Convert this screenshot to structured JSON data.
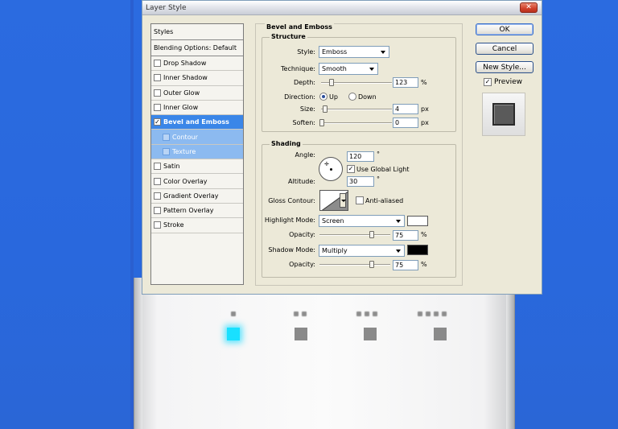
{
  "dialog": {
    "title": "Layer Style",
    "close_label": "✕"
  },
  "styles_list": {
    "header": "Styles",
    "blending": "Blending Options: Default",
    "items": [
      {
        "label": "Drop Shadow",
        "checked": ""
      },
      {
        "label": "Inner Shadow",
        "checked": ""
      },
      {
        "label": "Outer Glow",
        "checked": ""
      },
      {
        "label": "Inner Glow",
        "checked": ""
      },
      {
        "label": "Bevel and Emboss",
        "checked": "✓"
      },
      {
        "label": "Contour",
        "checked": ""
      },
      {
        "label": "Texture",
        "checked": ""
      },
      {
        "label": "Satin",
        "checked": ""
      },
      {
        "label": "Color Overlay",
        "checked": ""
      },
      {
        "label": "Gradient Overlay",
        "checked": ""
      },
      {
        "label": "Pattern Overlay",
        "checked": ""
      },
      {
        "label": "Stroke",
        "checked": ""
      }
    ]
  },
  "buttons": {
    "ok": "OK",
    "cancel": "Cancel",
    "new_style": "New Style...",
    "preview": "Preview",
    "preview_checked": "✓"
  },
  "bevel": {
    "title": "Bevel and Emboss",
    "structure": {
      "title": "Structure",
      "style_label": "Style:",
      "style_value": "Emboss",
      "technique_label": "Technique:",
      "technique_value": "Smooth",
      "depth_label": "Depth:",
      "depth_value": "123",
      "depth_unit": "%",
      "depth_fraction": 0.12,
      "direction_label": "Direction:",
      "direction_up": "Up",
      "direction_down": "Down",
      "size_label": "Size:",
      "size_value": "4",
      "size_unit": "px",
      "size_fraction": 0.02,
      "soften_label": "Soften:",
      "soften_value": "0",
      "soften_unit": "px",
      "soften_fraction": 0.0
    },
    "shading": {
      "title": "Shading",
      "angle_label": "Angle:",
      "angle_value": "120",
      "angle_unit": "°",
      "use_global_light": "Use Global Light",
      "use_global_light_checked": "✓",
      "altitude_label": "Altitude:",
      "altitude_value": "30",
      "altitude_unit": "°",
      "gloss_contour_label": "Gloss Contour:",
      "anti_aliased": "Anti-aliased",
      "highlight_mode_label": "Highlight Mode:",
      "highlight_mode_value": "Screen",
      "highlight_color": "#ffffff",
      "highlight_opacity_label": "Opacity:",
      "highlight_opacity_value": "75",
      "highlight_opacity_unit": "%",
      "highlight_opacity_fraction": 0.75,
      "shadow_mode_label": "Shadow Mode:",
      "shadow_mode_value": "Multiply",
      "shadow_color": "#000000",
      "shadow_opacity_label": "Opacity:",
      "shadow_opacity_value": "75",
      "shadow_opacity_unit": "%",
      "shadow_opacity_fraction": 0.75
    }
  },
  "colors": {
    "accent_selected": "#3a86e8",
    "glow": "#19e0ff",
    "desktop": "#2f6fe0"
  }
}
